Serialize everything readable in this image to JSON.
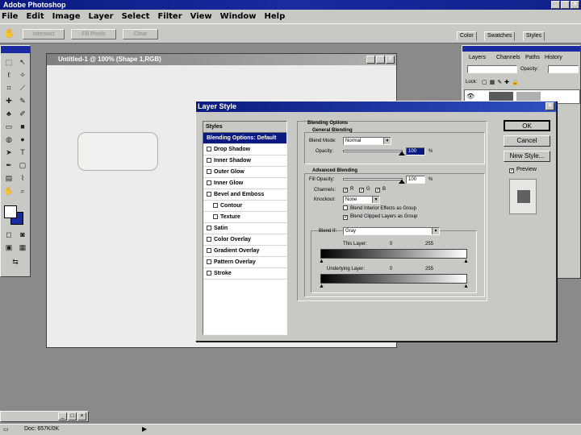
{
  "app": {
    "title": "Adobe Photoshop"
  },
  "menubar": [
    "File",
    "Edit",
    "Image",
    "Layer",
    "Select",
    "Filter",
    "View",
    "Window",
    "Help"
  ],
  "options_bar": {
    "buttons": [
      "Intersect",
      "Fill Pixels",
      "Clear"
    ]
  },
  "palette_tabs": [
    "Color",
    "Swatches",
    "Styles"
  ],
  "document": {
    "title": "Untitled-1 @ 100% (Shape 1,RGB)"
  },
  "layers_palette": {
    "tabs": [
      "Layers",
      "Channels",
      "Paths",
      "History"
    ],
    "opacity_label": "Opacity:",
    "lock_label": "Lock:"
  },
  "dialog": {
    "title": "Layer Style",
    "styles_header": "Styles",
    "styles": [
      {
        "label": "Blending Options: Default",
        "selected": true,
        "checkbox": false,
        "sub": false
      },
      {
        "label": "Drop Shadow",
        "selected": false,
        "checkbox": true,
        "sub": false
      },
      {
        "label": "Inner Shadow",
        "selected": false,
        "checkbox": true,
        "sub": false
      },
      {
        "label": "Outer Glow",
        "selected": false,
        "checkbox": true,
        "sub": false
      },
      {
        "label": "Inner Glow",
        "selected": false,
        "checkbox": true,
        "sub": false
      },
      {
        "label": "Bevel and Emboss",
        "selected": false,
        "checkbox": true,
        "sub": false
      },
      {
        "label": "Contour",
        "selected": false,
        "checkbox": true,
        "sub": true
      },
      {
        "label": "Texture",
        "selected": false,
        "checkbox": true,
        "sub": true
      },
      {
        "label": "Satin",
        "selected": false,
        "checkbox": true,
        "sub": false
      },
      {
        "label": "Color Overlay",
        "selected": false,
        "checkbox": true,
        "sub": false
      },
      {
        "label": "Gradient Overlay",
        "selected": false,
        "checkbox": true,
        "sub": false
      },
      {
        "label": "Pattern Overlay",
        "selected": false,
        "checkbox": true,
        "sub": false
      },
      {
        "label": "Stroke",
        "selected": false,
        "checkbox": true,
        "sub": false
      }
    ],
    "blending_options": {
      "section_title": "Blending Options",
      "general_title": "General Blending",
      "blend_mode_label": "Blend Mode:",
      "blend_mode_value": "Normal",
      "opacity_label": "Opacity:",
      "opacity_value": "100",
      "opacity_unit": "%",
      "opacity_level": 1.0,
      "advanced_title": "Advanced Blending",
      "fill_opacity_label": "Fill Opacity:",
      "fill_opacity_value": "100",
      "fill_opacity_unit": "%",
      "fill_opacity_level": 1.0,
      "channels_label": "Channels:",
      "channels": [
        "R",
        "G",
        "B"
      ],
      "knockout_label": "Knockout:",
      "knockout_value": "None",
      "blend_interior_label": "Blend Interior Effects as Group",
      "blend_clipped_label": "Blend Clipped Layers as Group",
      "blend_if_label": "Blend If:",
      "blend_if_value": "Gray",
      "this_layer_label": "This Layer:",
      "this_layer_min": "0",
      "this_layer_max": "255",
      "underlying_label": "Underlying Layer:",
      "underlying_min": "0",
      "underlying_max": "255"
    },
    "buttons": {
      "ok": "OK",
      "cancel": "Cancel",
      "new_style": "New Style...",
      "preview": "Preview"
    }
  },
  "status": {
    "doc_info": "Doc: 657K/0K"
  }
}
